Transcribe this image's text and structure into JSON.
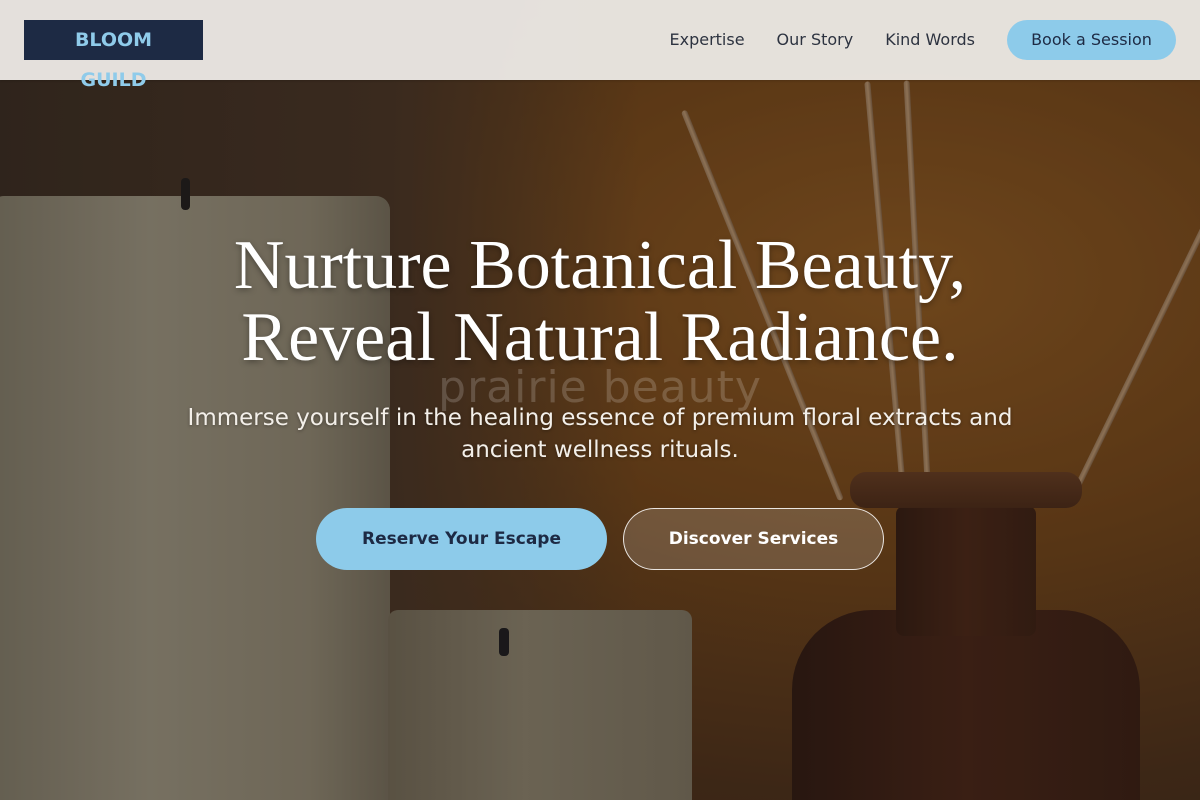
{
  "header": {
    "logo": "BLOOM GUILD",
    "nav": {
      "links": [
        "Expertise",
        "Our Story",
        "Kind Words"
      ],
      "cta": "Book a Session"
    }
  },
  "hero": {
    "title_line_1": "Nurture Botanical Beauty,",
    "title_line_2": "Reveal Natural Radiance.",
    "watermark": "prairie beauty",
    "subtitle": "Immerse yourself in the healing essence of premium floral extracts and ancient wellness rituals.",
    "primary_button": "Reserve Your Escape",
    "secondary_button": "Discover Services"
  },
  "colors": {
    "brand_navy": "#1d2a44",
    "accent_sky": "#8dcbea",
    "header_bg": "#ebe8e4"
  }
}
